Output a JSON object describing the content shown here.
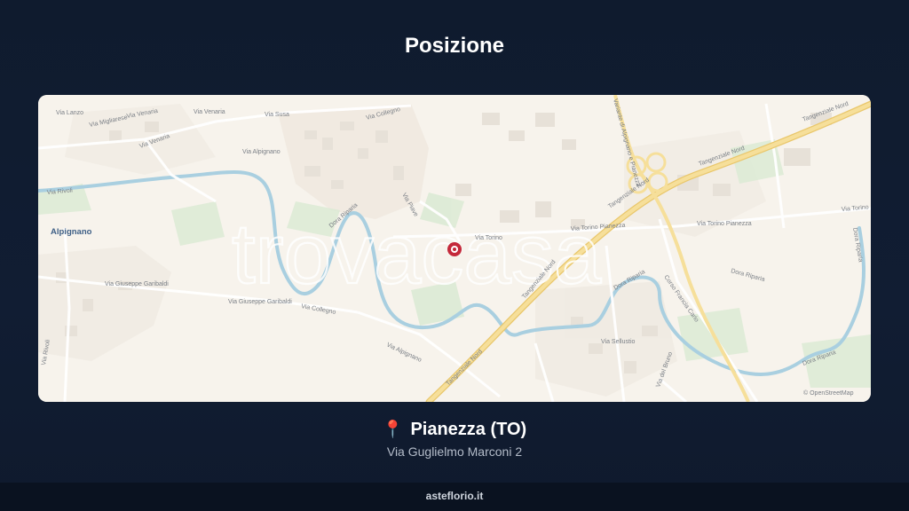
{
  "header": {
    "title": "Posizione"
  },
  "map": {
    "watermark": "trovacasa",
    "labels": {
      "via_lanzo": "Via Lanzo",
      "via_venaria_1": "Via Venaria",
      "via_venaria_2": "Via Venaria",
      "via_susa": "Via Susa",
      "via_collegno_top": "Via Collegno",
      "via_pianezza_top": "Via Pianezza",
      "via_alpignano_1": "Via Alpignano",
      "via_migliarese": "Via Migliarese",
      "via_rivoli": "Via Rivoli",
      "via_piave": "Via Piave",
      "via_torino": "Via Torino",
      "via_torino_pianezza_1": "Via Torino Pianezza",
      "via_torino_pianezza_2": "Via Torino Pianezza",
      "via_torino_right": "Via Torino",
      "tangenziale_nord_1": "Tangenziale Nord",
      "tangenziale_nord_2": "Tangenziale Nord",
      "tangenziale_nord_3": "Tangenziale Nord",
      "tangenziale_nord_4": "Tangenziale Nord",
      "tangenziale_nord_5": "Tangenziale Nord",
      "variante_alpignano": "Variante di Alpignano e Pianezza",
      "alpignano_town": "Alpignano",
      "via_garibaldi_1": "Via Giuseppe Garibaldi",
      "via_garibaldi_2": "Via Giuseppe Garibaldi",
      "via_collegno_mid": "Via Collegno",
      "via_alpignano_2": "Via Alpignano",
      "via_silvio": "Via Sellustio",
      "corso_francia": "Corso Francia Carlo",
      "dora_riparia_1": "Dora Riparia",
      "dora_riparia_2": "Dora Riparia",
      "dora_riparia_3": "Dora Riparia",
      "dora_riparia_4": "Dora Riparia",
      "via_del_bruno": "Via del Bruno",
      "via_rivoli_2": "Via Rivoli",
      "attribution": "© OpenStreetMap"
    },
    "colors": {
      "marker": "#c4283a",
      "highway": "#f4d98a",
      "river": "#a9cfe0"
    }
  },
  "location": {
    "pin_icon": "📍",
    "city": "Pianezza (TO)",
    "address": "Via Guglielmo Marconi 2"
  },
  "footer": {
    "brand": "asteflorio.it"
  }
}
